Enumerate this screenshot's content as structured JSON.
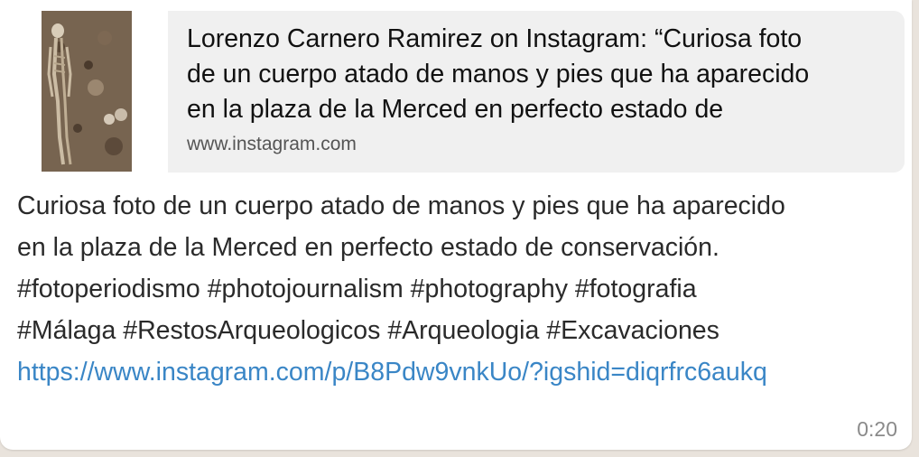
{
  "link_preview": {
    "thumbnail_icon": "excavation-skeleton-photo",
    "title": "Lorenzo Carnero Ramirez on Instagram: “Curiosa foto\nde un cuerpo atado de manos y pies que ha aparecido\nen la plaza de la Merced en perfecto estado de",
    "domain": "www.instagram.com"
  },
  "message": {
    "line1": "Curiosa foto de un cuerpo atado de manos y pies  que ha aparecido",
    "line2": "en la plaza de la Merced en perfecto estado de conservación.",
    "line3": "#fotoperiodismo #photojournalism #photography #fotografia",
    "line4": "#Málaga #RestosArqueologicos #Arqueologia #Excavaciones",
    "link": "https://www.instagram.com/p/B8Pdw9vnkUo/?igshid=diqrfrc6aukq"
  },
  "timestamp": "0:20",
  "colors": {
    "link": "#3a86c6",
    "preview_background": "#f0f0f0",
    "chat_background": "#e9e3dc"
  }
}
